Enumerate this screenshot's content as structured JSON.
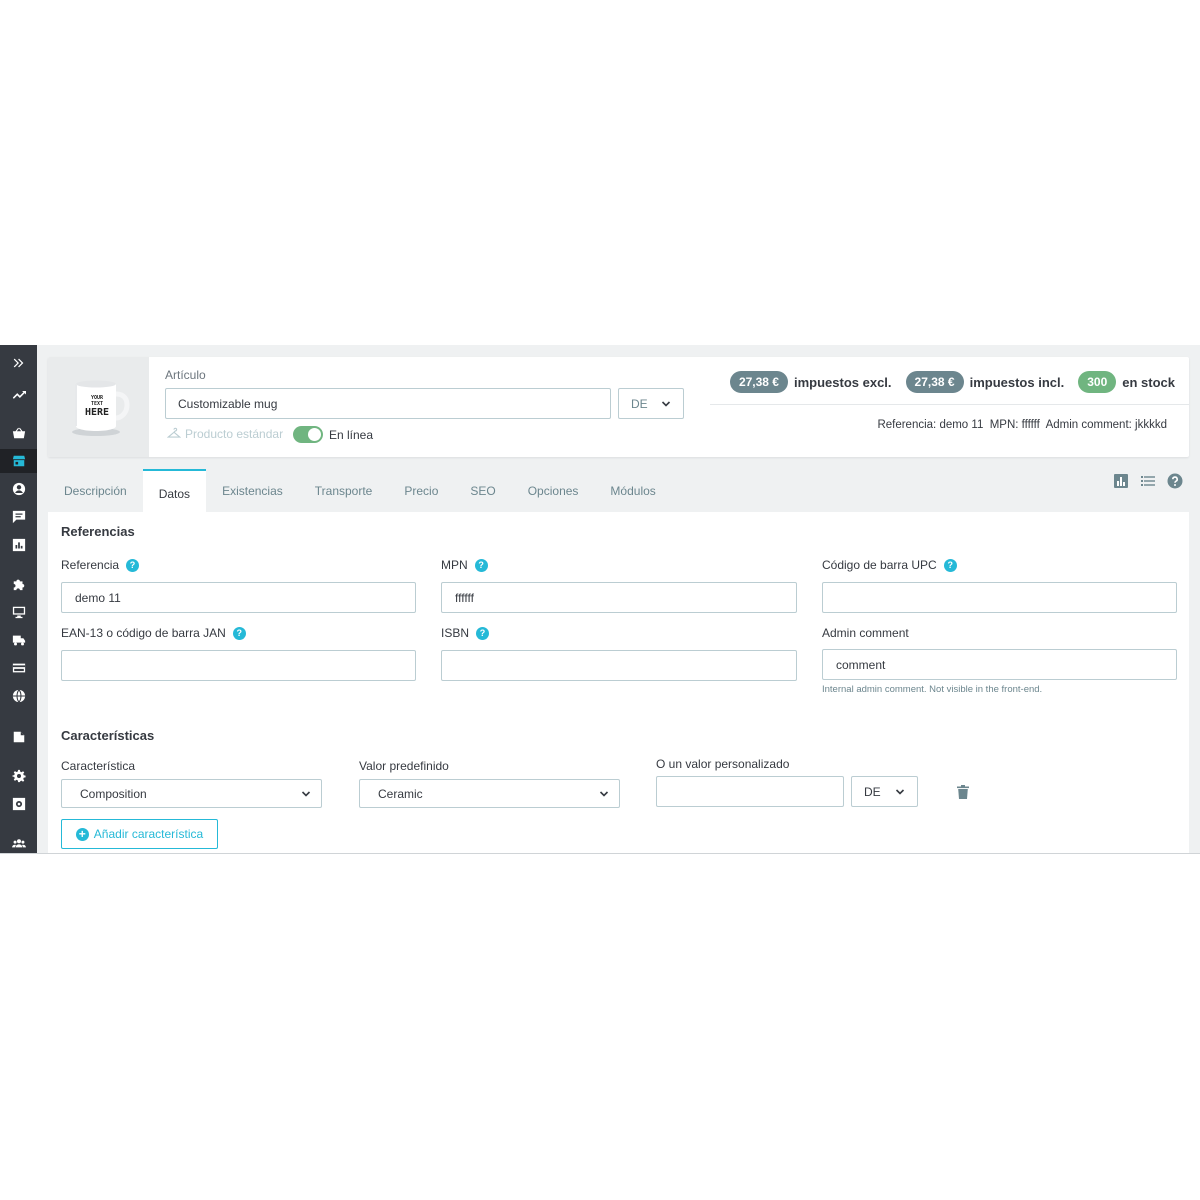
{
  "header": {
    "article_label": "Artículo",
    "product_name": "Customizable mug",
    "lang": "DE",
    "product_type": "Producto estándar",
    "online_label": "En línea",
    "online": true,
    "price_excl": "27,38 €",
    "price_excl_label": "impuestos excl.",
    "price_incl": "27,38 €",
    "price_incl_label": "impuestos incl.",
    "stock": "300",
    "stock_label": "en stock",
    "references_line": "Referencia: demo 11  MPN: ffffff  Admin comment: jkkkkd"
  },
  "thumbnail": {
    "mug_text_line1": "YOUR TEXT",
    "mug_text_line2": "HERE"
  },
  "tabs": [
    {
      "label": "Descripción",
      "active": false
    },
    {
      "label": "Datos",
      "active": true
    },
    {
      "label": "Existencias",
      "active": false
    },
    {
      "label": "Transporte",
      "active": false
    },
    {
      "label": "Precio",
      "active": false
    },
    {
      "label": "SEO",
      "active": false
    },
    {
      "label": "Opciones",
      "active": false
    },
    {
      "label": "Módulos",
      "active": false
    }
  ],
  "references": {
    "title": "Referencias",
    "reference_label": "Referencia",
    "reference_value": "demo 11",
    "mpn_label": "MPN",
    "mpn_value": "ffffff",
    "upc_label": "Código de barra UPC",
    "upc_value": "",
    "ean_label": "EAN-13 o código de barra JAN",
    "ean_value": "",
    "isbn_label": "ISBN",
    "isbn_value": "",
    "admin_comment_label": "Admin comment",
    "admin_comment_value": "comment",
    "admin_comment_hint": "Internal admin comment. Not visible in the front-end."
  },
  "features": {
    "title": "Características",
    "feature_label": "Característica",
    "feature_value": "Composition",
    "predefined_label": "Valor predefinido",
    "predefined_value": "Ceramic",
    "custom_label": "O un valor personalizado",
    "custom_value": "",
    "custom_lang": "DE",
    "add_button": "Añadir característica"
  },
  "colors": {
    "accent": "#25b9d7",
    "sidebar": "#363a41",
    "success": "#70b580",
    "pill_gray": "#6c868e"
  },
  "icons": [
    "expand-icon",
    "stats-trend-icon",
    "basket-icon",
    "store-icon",
    "user-icon",
    "chat-icon",
    "bar-chart-icon",
    "puzzle-icon",
    "monitor-icon",
    "truck-icon",
    "credit-card-icon",
    "globe-icon",
    "document-icon",
    "gear-icon",
    "settings-box-icon",
    "team-icon",
    "hanger-icon",
    "help-icon",
    "list-icon",
    "trash-icon",
    "plus-circle-icon",
    "chevron-down-icon"
  ]
}
